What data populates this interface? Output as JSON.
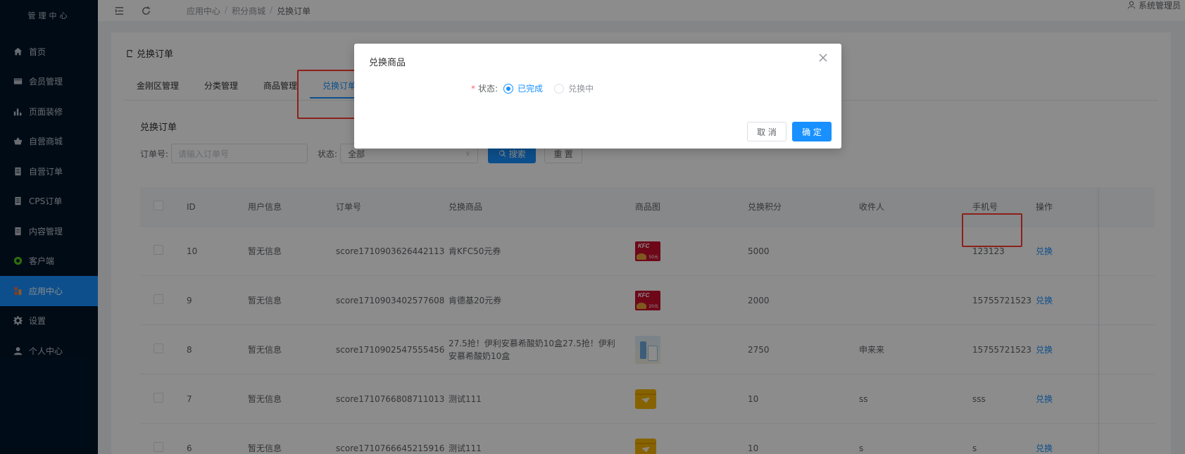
{
  "brand": {
    "top": "",
    "sub": "管理中心"
  },
  "sidebar": {
    "items": [
      {
        "label": "首页",
        "icon": "home-icon"
      },
      {
        "label": "会员管理",
        "icon": "card-icon"
      },
      {
        "label": "页面装修",
        "icon": "bar-chart-icon"
      },
      {
        "label": "自营商城",
        "icon": "basket-icon"
      },
      {
        "label": "自营订单",
        "icon": "document-icon"
      },
      {
        "label": "CPS订单",
        "icon": "document-icon"
      },
      {
        "label": "内容管理",
        "icon": "file-icon"
      },
      {
        "label": "客户端",
        "icon": "client-icon"
      },
      {
        "label": "应用中心",
        "icon": "app-icon",
        "active": true
      },
      {
        "label": "设置",
        "icon": "gear-icon"
      },
      {
        "label": "个人中心",
        "icon": "user-icon"
      }
    ]
  },
  "header": {
    "breadcrumb": [
      "应用中心",
      "积分商城",
      "兑换订单"
    ],
    "separator": "/",
    "user": "系统管理员"
  },
  "page": {
    "head": "兑换订单",
    "tabs": [
      {
        "label": "金刚区管理"
      },
      {
        "label": "分类管理"
      },
      {
        "label": "商品管理"
      },
      {
        "label": "兑换订单",
        "active": true
      }
    ],
    "section_title": "兑换订单"
  },
  "filters": {
    "order_label": "订单号:",
    "order_placeholder": "请输入订单号",
    "status_label": "状态:",
    "status_value": "全部",
    "search_label": "搜索",
    "reset_label": "重 置"
  },
  "table": {
    "headers": [
      "ID",
      "用户信息",
      "订单号",
      "兑换商品",
      "商品图",
      "兑换积分",
      "收件人",
      "手机号",
      "操作"
    ],
    "rows": [
      {
        "id": "10",
        "user": "暂无信息",
        "order": "score1710903626442113",
        "product": "肯KFC50元券",
        "img": "kfc",
        "img_num": "50元",
        "score": "5000",
        "receiver": "",
        "phone": "123123",
        "op": "兑换"
      },
      {
        "id": "9",
        "user": "暂无信息",
        "order": "score1710903402577608",
        "product": "肯德基20元券",
        "img": "kfc",
        "img_num": "20元",
        "score": "2000",
        "receiver": "",
        "phone": "15755721523",
        "op": "兑换"
      },
      {
        "id": "8",
        "user": "暂无信息",
        "order": "score1710902547555456",
        "product": "27.5抢！伊利安慕希酸奶10盒27.5抢！伊利安慕希酸奶10盒",
        "img": "milk",
        "img_num": "",
        "score": "2750",
        "receiver": "申来来",
        "phone": "15755721523",
        "op": "兑换"
      },
      {
        "id": "7",
        "user": "暂无信息",
        "order": "score1710766808711013",
        "product": "测试111",
        "img": "box",
        "img_num": "",
        "score": "10",
        "receiver": "ss",
        "phone": "sss",
        "op": "兑换"
      },
      {
        "id": "6",
        "user": "暂无信息",
        "order": "score1710766645215916",
        "product": "测试111",
        "img": "box",
        "img_num": "",
        "score": "10",
        "receiver": "s",
        "phone": "s",
        "op": "兑换"
      }
    ],
    "kfc_text": "KFC"
  },
  "modal": {
    "title": "兑换商品",
    "status_label": "状态:",
    "options": [
      {
        "label": "已完成",
        "checked": true
      },
      {
        "label": "兑换中",
        "checked": false
      }
    ],
    "cancel_label": "取 消",
    "ok_label": "确 定"
  },
  "colors": {
    "primary": "#1890ff",
    "sidebar_bg": "#001529",
    "highlight": "#ff3b30"
  }
}
